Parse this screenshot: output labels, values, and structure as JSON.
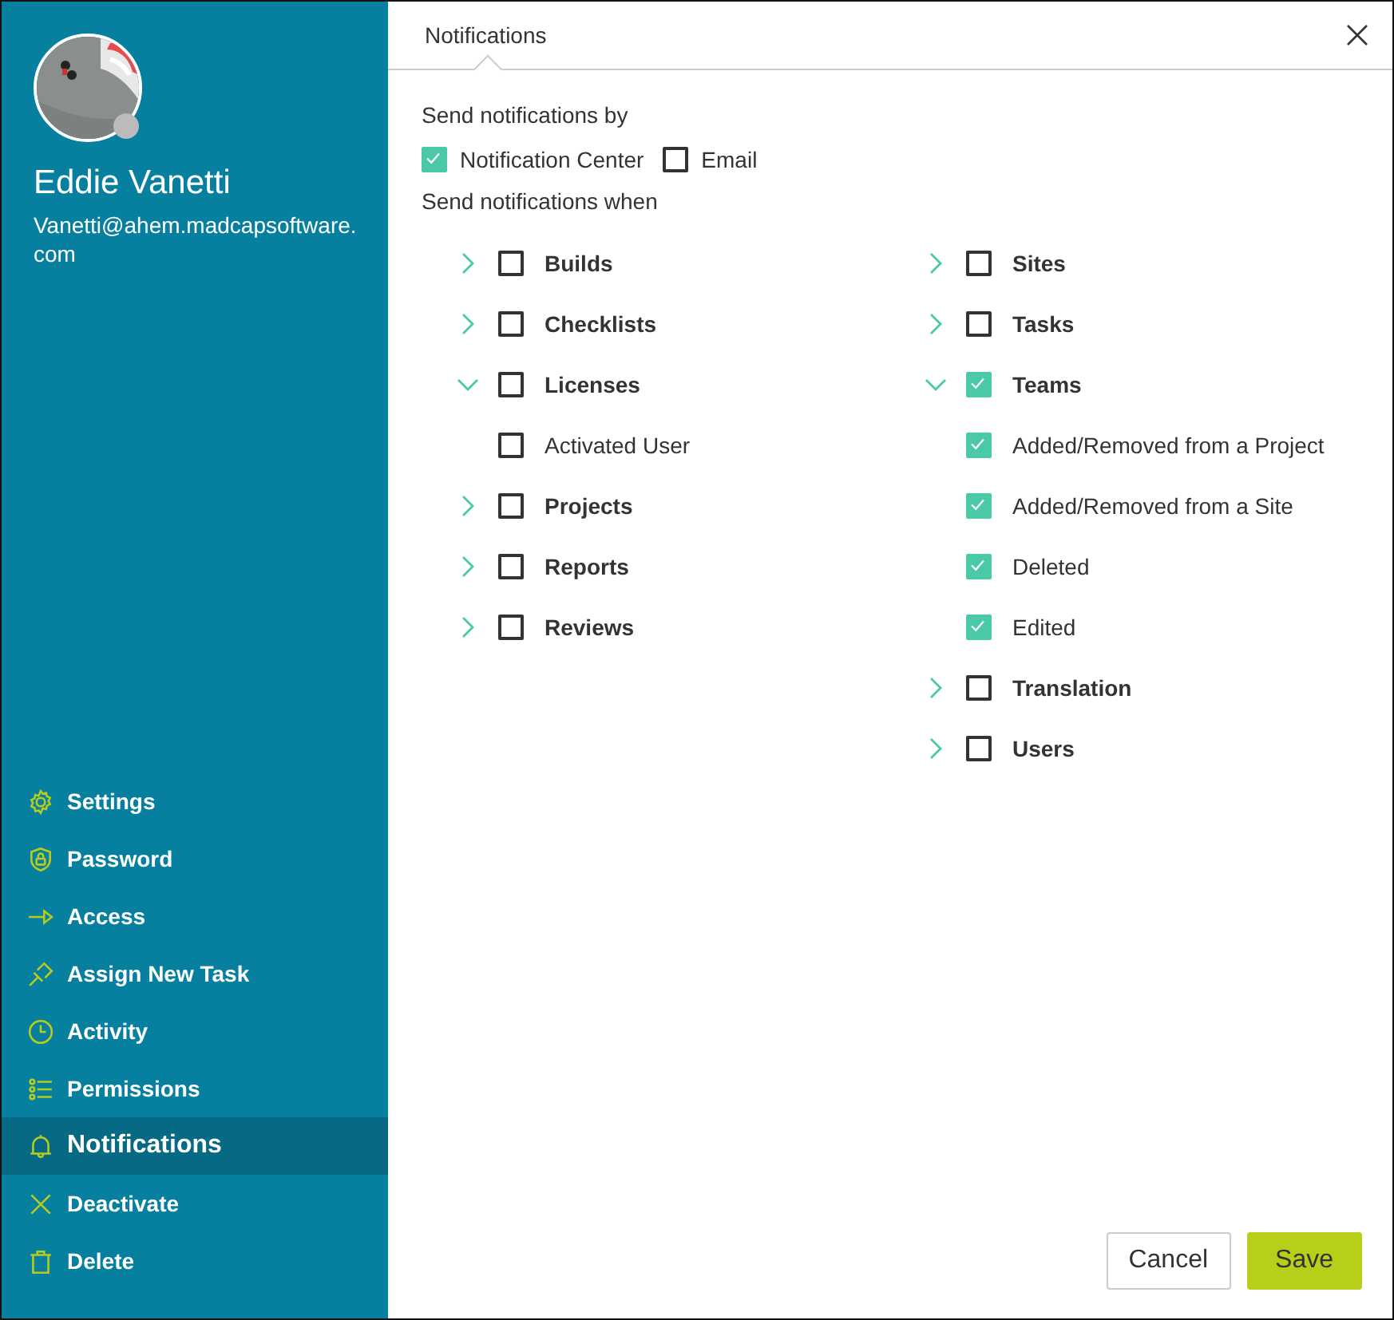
{
  "profile": {
    "name": "Eddie Vanetti",
    "email": "Vanetti@ahem.madcapsoftware.com"
  },
  "sidebar": {
    "items": [
      {
        "label": "Settings",
        "selected": false
      },
      {
        "label": "Password",
        "selected": false
      },
      {
        "label": "Access",
        "selected": false
      },
      {
        "label": "Assign New Task",
        "selected": false
      },
      {
        "label": "Activity",
        "selected": false
      },
      {
        "label": "Permissions",
        "selected": false
      },
      {
        "label": "Notifications",
        "selected": true
      },
      {
        "label": "Deactivate",
        "selected": false
      },
      {
        "label": "Delete",
        "selected": false
      }
    ]
  },
  "dialog": {
    "tab": "Notifications",
    "by_label": "Send notifications by",
    "channels": [
      {
        "label": "Notification Center",
        "checked": true
      },
      {
        "label": "Email",
        "checked": false
      }
    ],
    "when_label": "Send notifications when",
    "columns": [
      {
        "groups": [
          {
            "label": "Builds",
            "checked": false,
            "expanded": false
          },
          {
            "label": "Checklists",
            "checked": false,
            "expanded": false
          },
          {
            "label": "Licenses",
            "checked": false,
            "expanded": true,
            "children": [
              {
                "label": "Activated User",
                "checked": false
              }
            ]
          },
          {
            "label": "Projects",
            "checked": false,
            "expanded": false
          },
          {
            "label": "Reports",
            "checked": false,
            "expanded": false
          },
          {
            "label": "Reviews",
            "checked": false,
            "expanded": false
          }
        ]
      },
      {
        "groups": [
          {
            "label": "Sites",
            "checked": false,
            "expanded": false
          },
          {
            "label": "Tasks",
            "checked": false,
            "expanded": false
          },
          {
            "label": "Teams",
            "checked": true,
            "expanded": true,
            "children": [
              {
                "label": "Added/Removed from a Project",
                "checked": true
              },
              {
                "label": "Added/Removed from a Site",
                "checked": true
              },
              {
                "label": "Deleted",
                "checked": true
              },
              {
                "label": "Edited",
                "checked": true
              }
            ]
          },
          {
            "label": "Translation",
            "checked": false,
            "expanded": false
          },
          {
            "label": "Users",
            "checked": false,
            "expanded": false
          }
        ]
      }
    ],
    "buttons": {
      "cancel": "Cancel",
      "save": "Save"
    }
  }
}
